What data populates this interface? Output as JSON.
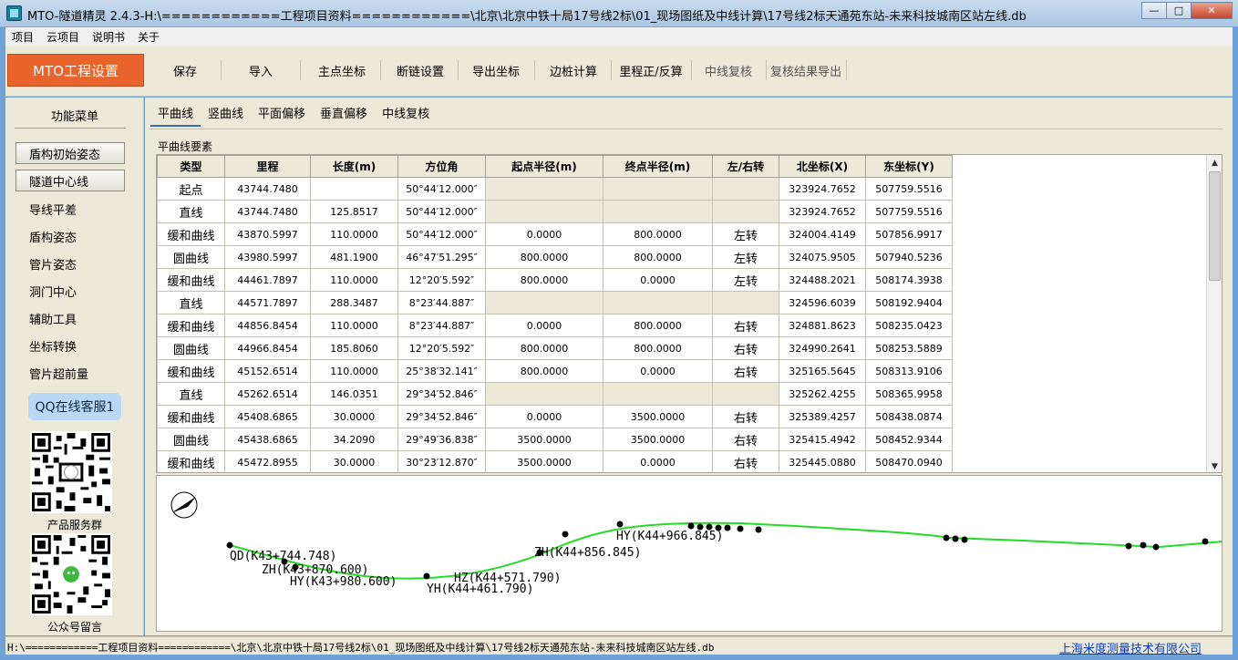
{
  "window": {
    "title": "MTO-隧道精灵 2.4.3-H:\\============工程项目资料============\\北京\\北京中铁十局17号线2标\\01_现场图纸及中线计算\\17号线2标天通苑东站-未来科技城南区站左线.db",
    "min": "—",
    "max": "□",
    "close": "✕"
  },
  "menu": [
    "项目",
    "云项目",
    "说明书",
    "关于"
  ],
  "toolbar": {
    "brand": "MTO工程设置",
    "buttons": [
      "保存",
      "导入",
      "主点坐标",
      "断链设置",
      "导出坐标",
      "边桩计算",
      "里程正/反算",
      "中线复核",
      "复核结果导出"
    ]
  },
  "left": {
    "title": "功能菜单",
    "buttons": [
      "盾构初始姿态",
      "隧道中心线"
    ],
    "items": [
      "导线平差",
      "盾构姿态",
      "管片姿态",
      "洞门中心",
      "辅助工具",
      "坐标转换",
      "管片超前量"
    ],
    "qq": "QQ在线客服1",
    "qr1_label": "产品服务群",
    "qr2_label": "公众号留言"
  },
  "tabs": [
    "平曲线",
    "竖曲线",
    "平面偏移",
    "垂直偏移",
    "中线复核"
  ],
  "group_title": "平曲线要素",
  "table": {
    "headers": [
      "类型",
      "里程",
      "长度(m)",
      "方位角",
      "起点半径(m)",
      "终点半径(m)",
      "左/右转",
      "北坐标(X)",
      "东坐标(Y)"
    ],
    "rows": [
      [
        "起点",
        "43744.7480",
        "",
        "50°44′12.000″",
        "",
        "",
        "",
        "323924.7652",
        "507759.5516"
      ],
      [
        "直线",
        "43744.7480",
        "125.8517",
        "50°44′12.000″",
        "",
        "",
        "",
        "323924.7652",
        "507759.5516"
      ],
      [
        "缓和曲线",
        "43870.5997",
        "110.0000",
        "50°44′12.000″",
        "0.0000",
        "800.0000",
        "左转",
        "324004.4149",
        "507856.9917"
      ],
      [
        "圆曲线",
        "43980.5997",
        "481.1900",
        "46°47′51.295″",
        "800.0000",
        "800.0000",
        "左转",
        "324075.9505",
        "507940.5236"
      ],
      [
        "缓和曲线",
        "44461.7897",
        "110.0000",
        "12°20′5.592″",
        "800.0000",
        "0.0000",
        "左转",
        "324488.2021",
        "508174.3938"
      ],
      [
        "直线",
        "44571.7897",
        "288.3487",
        "8°23′44.887″",
        "",
        "",
        "",
        "324596.6039",
        "508192.9404"
      ],
      [
        "缓和曲线",
        "44856.8454",
        "110.0000",
        "8°23′44.887″",
        "0.0000",
        "800.0000",
        "右转",
        "324881.8623",
        "508235.0423"
      ],
      [
        "圆曲线",
        "44966.8454",
        "185.8060",
        "12°20′5.592″",
        "800.0000",
        "800.0000",
        "右转",
        "324990.2641",
        "508253.5889"
      ],
      [
        "缓和曲线",
        "45152.6514",
        "110.0000",
        "25°38′32.141″",
        "800.0000",
        "0.0000",
        "右转",
        "325165.5645",
        "508313.9106"
      ],
      [
        "直线",
        "45262.6514",
        "146.0351",
        "29°34′52.846″",
        "",
        "",
        "",
        "325262.4255",
        "508365.9958"
      ],
      [
        "缓和曲线",
        "45408.6865",
        "30.0000",
        "29°34′52.846″",
        "0.0000",
        "3500.0000",
        "右转",
        "325389.4257",
        "508438.0874"
      ],
      [
        "圆曲线",
        "45438.6865",
        "34.2090",
        "29°49′36.838″",
        "3500.0000",
        "3500.0000",
        "右转",
        "325415.4942",
        "508452.9344"
      ],
      [
        "缓和曲线",
        "45472.8955",
        "30.0000",
        "30°23′12.870″",
        "3500.0000",
        "0.0000",
        "右转",
        "325445.0880",
        "508470.0940"
      ]
    ]
  },
  "scroll": {
    "up": "▲",
    "down": "▼"
  },
  "canvas": {
    "curve_color": "#22dd22",
    "labels": [
      "QD(K43+744.748)",
      "ZH(K43+870.600)",
      "HY(K43+980.600)",
      "YH(K44+461.790)",
      "HZ(K44+571.790)",
      "ZH(K44+856.845)",
      "HY(K44+966.845)"
    ]
  },
  "status": {
    "path": "H:\\============工程项目资料============\\北京\\北京中铁十局17号线2标\\01_现场图纸及中线计算\\17号线2标天通苑东站-未来科技城南区站左线.db",
    "company": "上海米度测量技术有限公司"
  }
}
